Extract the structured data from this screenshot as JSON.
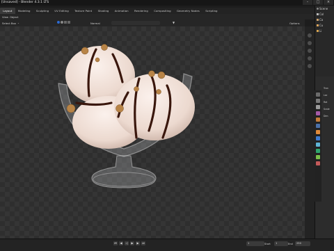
{
  "window": {
    "title": "[Unsaved] - Blender 4.3.1 LTS",
    "buttons": [
      "–",
      "□",
      "×"
    ]
  },
  "workspace_tabs": [
    {
      "label": "Layout",
      "active": true
    },
    {
      "label": "Modeling"
    },
    {
      "label": "Sculpting"
    },
    {
      "label": "UV Editing"
    },
    {
      "label": "Texture Paint"
    },
    {
      "label": "Shading"
    },
    {
      "label": "Animation"
    },
    {
      "label": "Rendering"
    },
    {
      "label": "Compositing"
    },
    {
      "label": "Geometry Nodes"
    },
    {
      "label": "Scripting"
    }
  ],
  "viewport_header": {
    "view_label": "View",
    "object_label": "Object",
    "select_mode": "Select Box",
    "orientation": "Normal",
    "options_label": "Options"
  },
  "outliner": {
    "header": "Scene",
    "rows": [
      "Scene",
      "Col",
      "Ca",
      "Cu",
      "Li"
    ]
  },
  "properties": {
    "rows": [
      "Tran",
      "Loc",
      "Rot",
      "Scale",
      "Dim"
    ]
  },
  "timeline": {
    "start_label": "Start",
    "start_value": "1",
    "end_label": "End",
    "end_value": "250",
    "current_frame": "1"
  },
  "colors": {
    "accent": "#4772b3",
    "viewport_bg": "#2e2e2e",
    "ice_cream": "#efe0d8",
    "chocolate": "#3a170d",
    "nut": "#b88447"
  }
}
